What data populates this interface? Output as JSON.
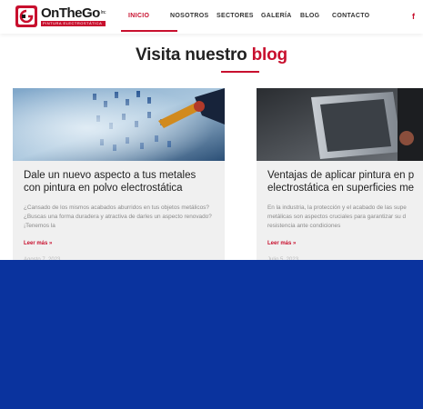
{
  "header": {
    "logo": {
      "name_on": "OnThe",
      "name_go": "Go",
      "sup": "Inc",
      "tagline": "PINTURA ELECTROSTÁTICA"
    },
    "nav": [
      "INICIO",
      "NOSOTROS",
      "SECTORES",
      "GALERÍA",
      "BLOG",
      "CONTACTO"
    ],
    "active_nav": "INICIO",
    "social_icon": "f"
  },
  "section": {
    "title_plain": "Visita nuestro",
    "title_accent": "blog"
  },
  "posts": [
    {
      "title_line1": "Dale un nuevo aspecto a tus metales",
      "title_line2": "con pintura en polvo electrostática",
      "excerpt": "¿Cansado de los mismos acabados aburridos en tus objetos metálicos? ¿Buscas una forma duradera y atractiva de darles un aspecto renovado? ¡Tenemos la",
      "read_more": "Leer más »",
      "date": "Agosto 7, 2023"
    },
    {
      "title_line1": "Ventajas de aplicar pintura en p",
      "title_line2": "electrostática en superficies me",
      "excerpt_l1": "En la industria, la protección y el acabado de las supe",
      "excerpt_l2": "metálicas son aspectos cruciales para garantizar su d",
      "excerpt_l3": "resistencia ante condiciones",
      "read_more": "Leer más »",
      "date": "Julio 5, 2023"
    }
  ],
  "colors": {
    "accent": "#c8102e",
    "overlay": "#0a339e",
    "card_bg": "#f0f0f0"
  }
}
